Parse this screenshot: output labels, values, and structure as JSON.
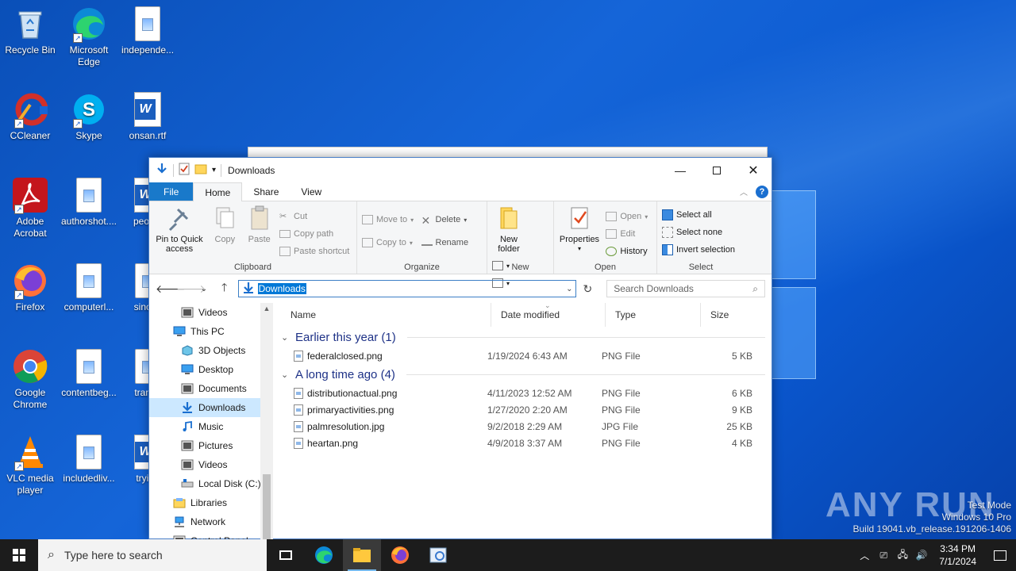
{
  "desktop": {
    "icons": [
      {
        "label": "Recycle Bin"
      },
      {
        "label": "Microsoft Edge"
      },
      {
        "label": "independe..."
      },
      {
        "label": "CCleaner"
      },
      {
        "label": "Skype"
      },
      {
        "label": "onsan.rtf"
      },
      {
        "label": "Adobe Acrobat"
      },
      {
        "label": "authorshot...."
      },
      {
        "label": "people"
      },
      {
        "label": "Firefox"
      },
      {
        "label": "computerl..."
      },
      {
        "label": "sinceu"
      },
      {
        "label": "Google Chrome"
      },
      {
        "label": "contentbeg..."
      },
      {
        "label": "transp"
      },
      {
        "label": "VLC media player"
      },
      {
        "label": "includedliv..."
      },
      {
        "label": "trying"
      }
    ]
  },
  "explorer": {
    "title": "Downloads",
    "tabs": [
      "File",
      "Home",
      "Share",
      "View"
    ],
    "ribbon": {
      "clipboard": {
        "label": "Clipboard",
        "pin": "Pin to Quick access",
        "copy": "Copy",
        "paste": "Paste",
        "cut": "Cut",
        "copy_path": "Copy path",
        "paste_shortcut": "Paste shortcut"
      },
      "organize": {
        "label": "Organize",
        "move_to": "Move to",
        "copy_to": "Copy to",
        "delete": "Delete",
        "rename": "Rename"
      },
      "new": {
        "label": "New",
        "new_folder": "New folder"
      },
      "open": {
        "label": "Open",
        "properties": "Properties",
        "open": "Open",
        "edit": "Edit",
        "history": "History"
      },
      "select": {
        "label": "Select",
        "select_all": "Select all",
        "select_none": "Select none",
        "invert": "Invert selection"
      }
    },
    "address": "Downloads",
    "search_placeholder": "Search Downloads",
    "nav": [
      {
        "label": "Videos",
        "indent": 2
      },
      {
        "label": "This PC",
        "indent": 1
      },
      {
        "label": "3D Objects",
        "indent": 2
      },
      {
        "label": "Desktop",
        "indent": 2
      },
      {
        "label": "Documents",
        "indent": 2
      },
      {
        "label": "Downloads",
        "indent": 2,
        "selected": true
      },
      {
        "label": "Music",
        "indent": 2
      },
      {
        "label": "Pictures",
        "indent": 2
      },
      {
        "label": "Videos",
        "indent": 2
      },
      {
        "label": "Local Disk (C:)",
        "indent": 2
      },
      {
        "label": "Libraries",
        "indent": 1
      },
      {
        "label": "Network",
        "indent": 1
      },
      {
        "label": "Control Panel",
        "indent": 1
      }
    ],
    "columns": {
      "name": "Name",
      "date": "Date modified",
      "type": "Type",
      "size": "Size"
    },
    "groups": [
      {
        "title": "Earlier this year (1)",
        "files": [
          {
            "name": "federalclosed.png",
            "date": "1/19/2024 6:43 AM",
            "type": "PNG File",
            "size": "5 KB"
          }
        ]
      },
      {
        "title": "A long time ago (4)",
        "files": [
          {
            "name": "distributionactual.png",
            "date": "4/11/2023 12:52 AM",
            "type": "PNG File",
            "size": "6 KB"
          },
          {
            "name": "primaryactivities.png",
            "date": "1/27/2020 2:20 AM",
            "type": "PNG File",
            "size": "9 KB"
          },
          {
            "name": "palmresolution.jpg",
            "date": "9/2/2018 2:29 AM",
            "type": "JPG File",
            "size": "25 KB"
          },
          {
            "name": "heartan.png",
            "date": "4/9/2018 3:37 AM",
            "type": "PNG File",
            "size": "4 KB"
          }
        ]
      }
    ]
  },
  "taskbar": {
    "search_placeholder": "Type here to search",
    "time": "3:34 PM",
    "date": "7/1/2024"
  },
  "watermark": {
    "line1": "Test Mode",
    "line2": "Windows 10 Pro",
    "line3": "Build 19041.vb_release.191206-1406",
    "brand": "ANY RUN"
  }
}
